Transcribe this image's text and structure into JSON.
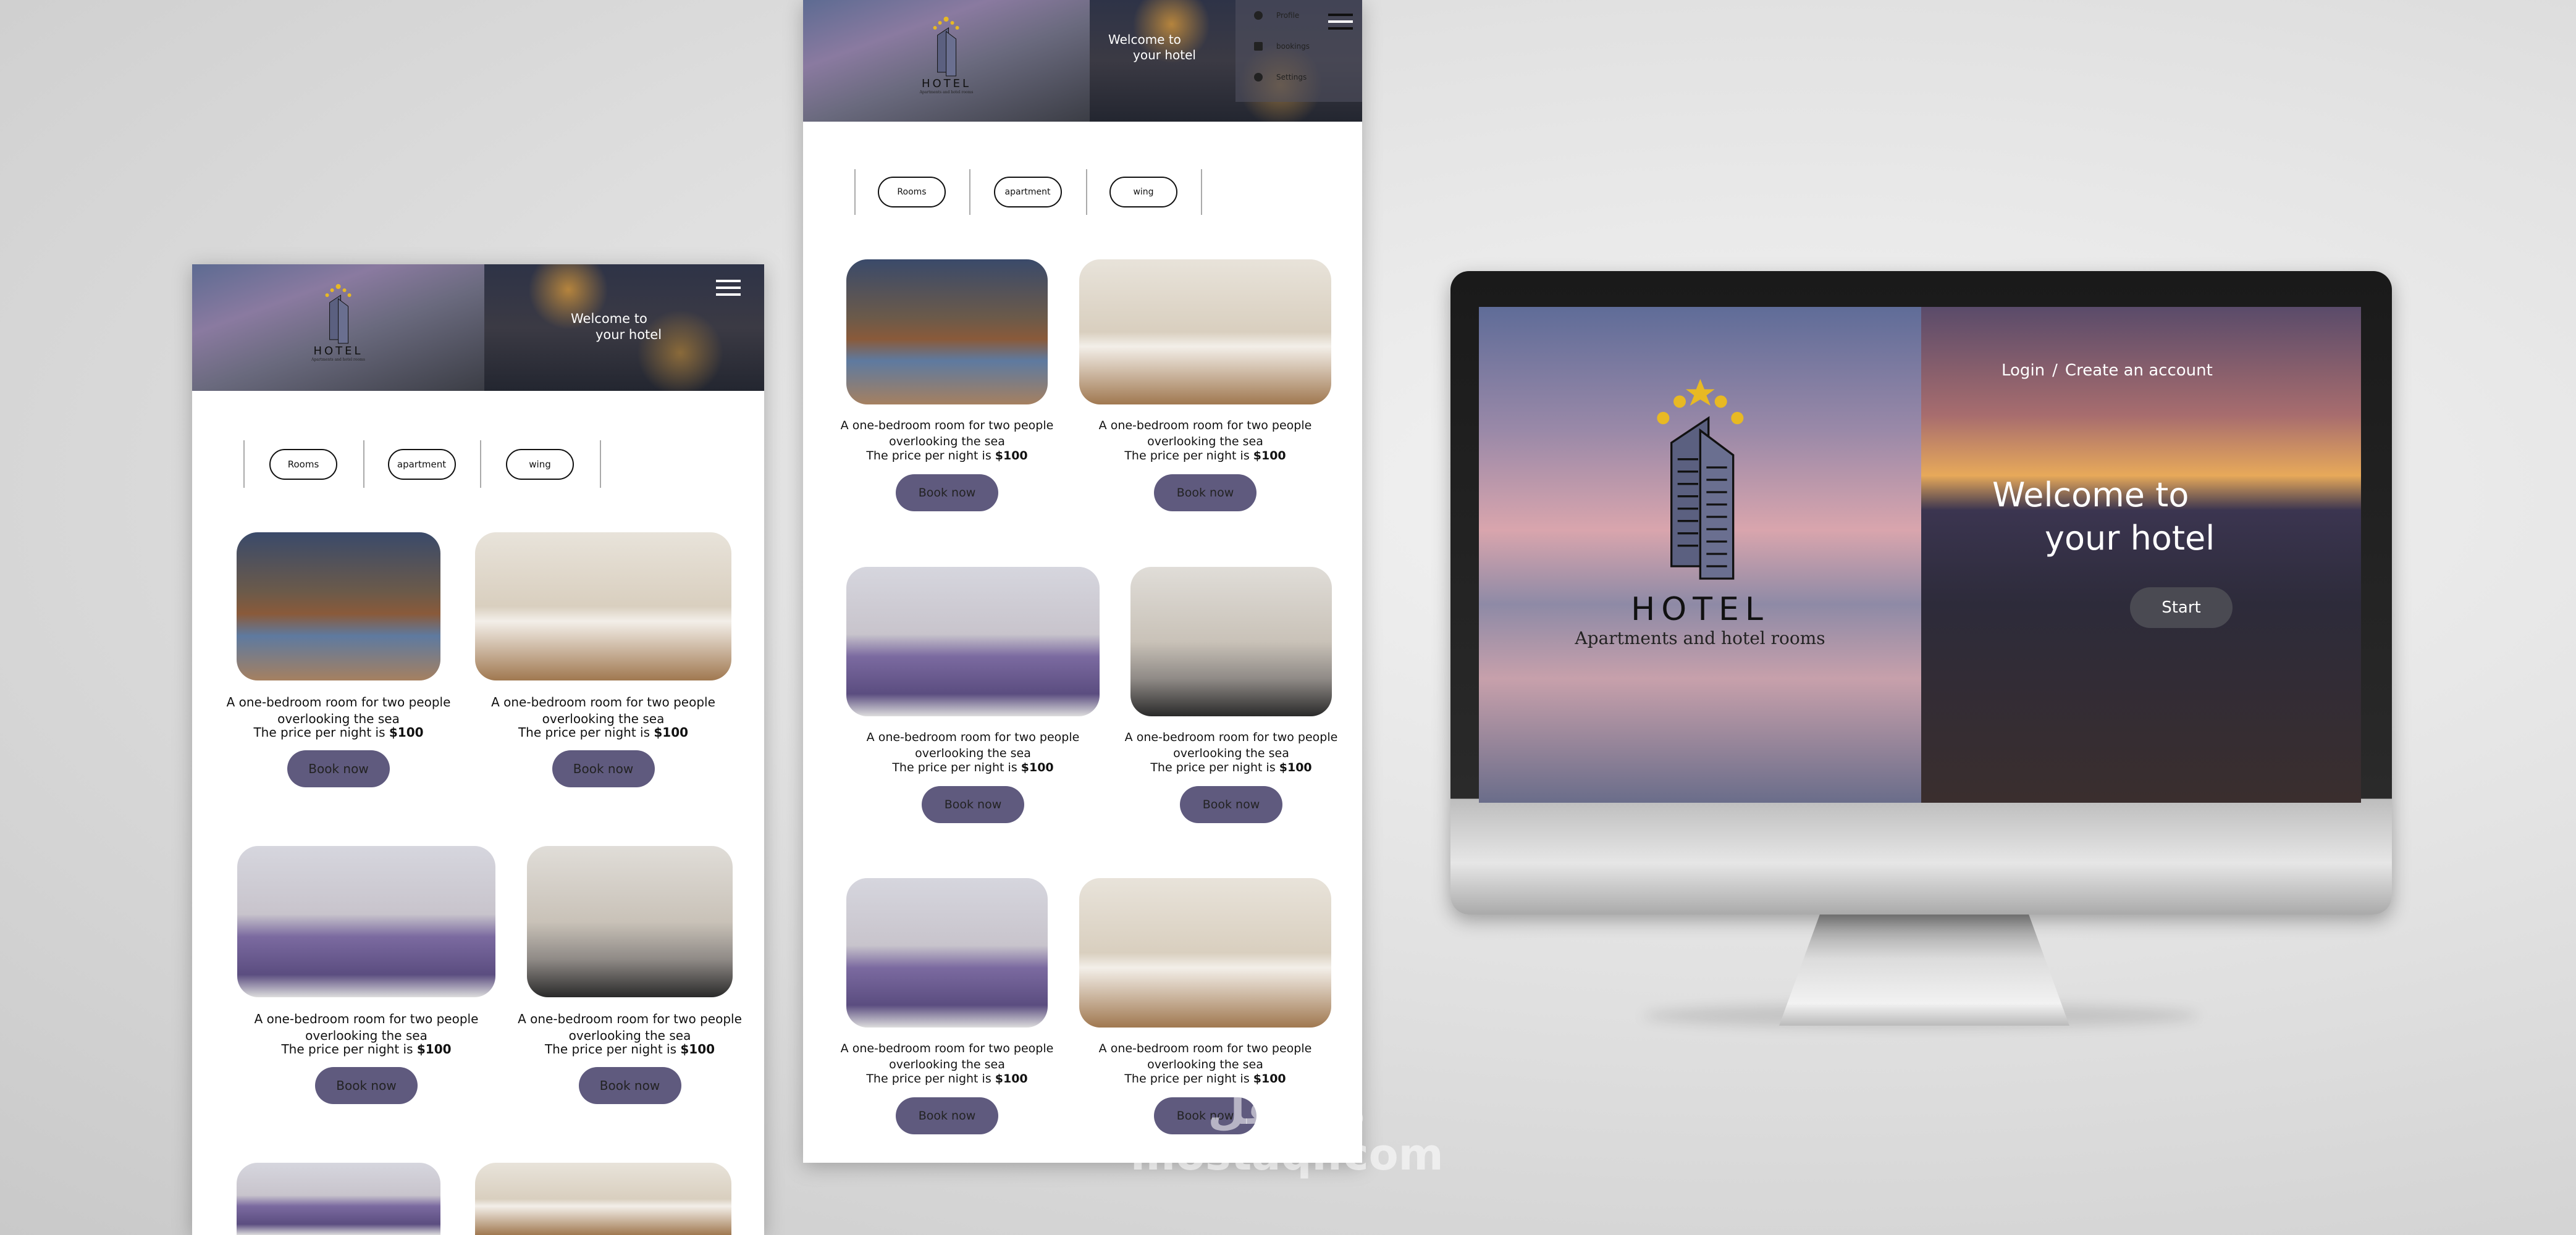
{
  "brand": {
    "name": "HOTEL",
    "tagline": "Apartments and hotel rooms"
  },
  "header": {
    "welcome_line1": "Welcome to",
    "welcome_line2": "your hotel"
  },
  "menu": {
    "items": [
      {
        "label": "Profile",
        "icon": "user-icon"
      },
      {
        "label": "bookings",
        "icon": "shopping-bag-icon"
      },
      {
        "label": "Settings",
        "icon": "gear-icon"
      }
    ]
  },
  "categories": [
    "Rooms",
    "apartment",
    "wing"
  ],
  "card": {
    "desc": "A one-bedroom room for two people overlooking the sea",
    "price_label": "The price per night is ",
    "price_value": "$100",
    "button": "Book now"
  },
  "desktop": {
    "login": "Login",
    "separator": "/",
    "create_account": "Create an account",
    "welcome_line1": "Welcome to",
    "welcome_line2": "your hotel",
    "start": "Start"
  },
  "colors": {
    "button": "#5f5a7e",
    "star": "#e8b923",
    "building": "#5b6080"
  },
  "watermark": {
    "arabic": "مستقل",
    "latin": "mostaql.com"
  }
}
